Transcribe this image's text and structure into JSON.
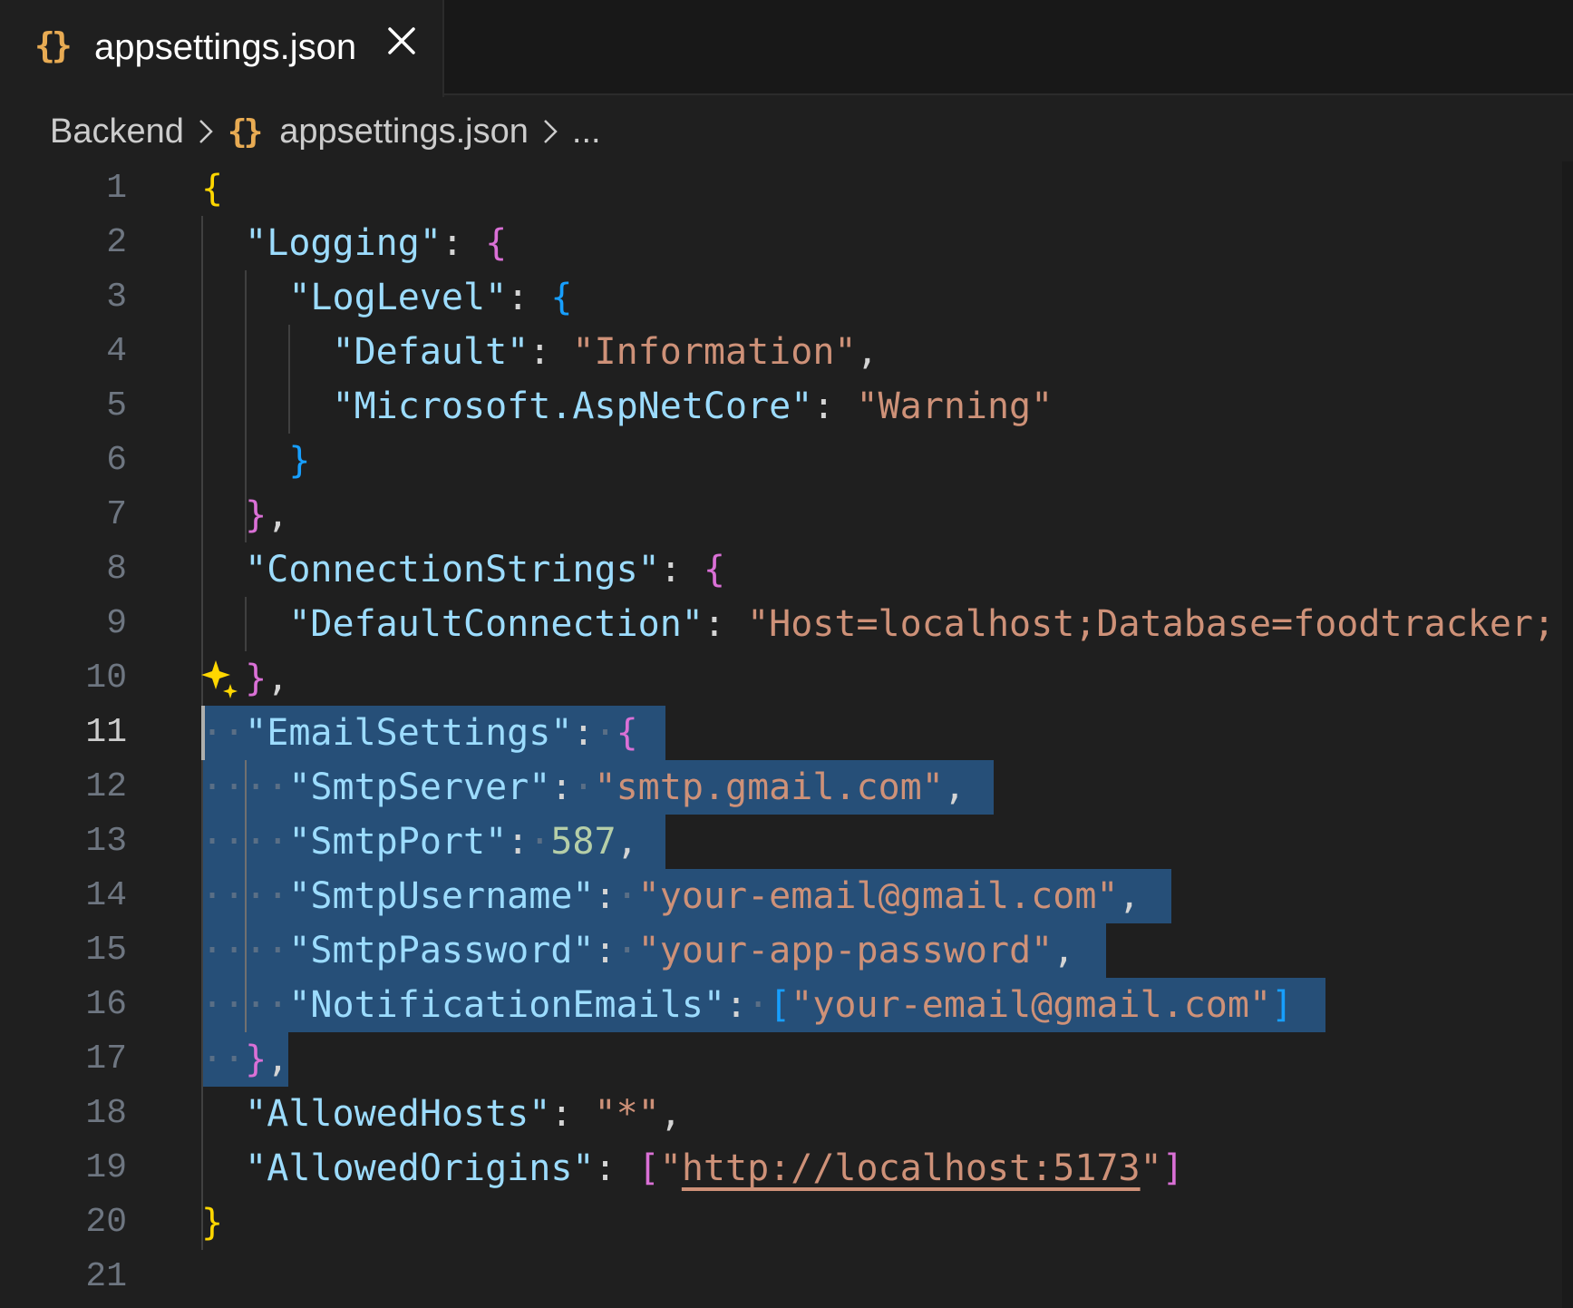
{
  "tab": {
    "icon": "{}",
    "filename": "appsettings.json",
    "close_icon": "close-icon"
  },
  "breadcrumb": {
    "folder": "Backend",
    "icon": "{}",
    "file": "appsettings.json",
    "more": "..."
  },
  "editor": {
    "active_line": 11,
    "line_numbers": [
      "1",
      "2",
      "3",
      "4",
      "5",
      "6",
      "7",
      "8",
      "9",
      "10",
      "11",
      "12",
      "13",
      "14",
      "15",
      "16",
      "17",
      "18",
      "19",
      "20",
      "21"
    ],
    "lines": [
      [
        {
          "t": "{",
          "c": "b1"
        }
      ],
      [
        {
          "t": "  "
        },
        {
          "t": "\"Logging\"",
          "c": "k"
        },
        {
          "t": ": ",
          "c": "p"
        },
        {
          "t": "{",
          "c": "b2"
        }
      ],
      [
        {
          "t": "    "
        },
        {
          "t": "\"LogLevel\"",
          "c": "k"
        },
        {
          "t": ": ",
          "c": "p"
        },
        {
          "t": "{",
          "c": "b3"
        }
      ],
      [
        {
          "t": "      "
        },
        {
          "t": "\"Default\"",
          "c": "k"
        },
        {
          "t": ": ",
          "c": "p"
        },
        {
          "t": "\"Information\"",
          "c": "s"
        },
        {
          "t": ",",
          "c": "p"
        }
      ],
      [
        {
          "t": "      "
        },
        {
          "t": "\"Microsoft.AspNetCore\"",
          "c": "k"
        },
        {
          "t": ": ",
          "c": "p"
        },
        {
          "t": "\"Warning\"",
          "c": "s"
        }
      ],
      [
        {
          "t": "    "
        },
        {
          "t": "}",
          "c": "b3"
        }
      ],
      [
        {
          "t": "  "
        },
        {
          "t": "}",
          "c": "b2"
        },
        {
          "t": ",",
          "c": "p"
        }
      ],
      [
        {
          "t": "  "
        },
        {
          "t": "\"ConnectionStrings\"",
          "c": "k"
        },
        {
          "t": ": ",
          "c": "p"
        },
        {
          "t": "{",
          "c": "b2"
        }
      ],
      [
        {
          "t": "    "
        },
        {
          "t": "\"DefaultConnection\"",
          "c": "k"
        },
        {
          "t": ": ",
          "c": "p"
        },
        {
          "t": "\"Host=localhost;Database=foodtracker;",
          "c": "s"
        }
      ],
      [
        {
          "t": "  "
        },
        {
          "t": "}",
          "c": "b2"
        },
        {
          "t": ",",
          "c": "p"
        }
      ],
      [
        {
          "t": "··",
          "c": "wsdot"
        },
        {
          "t": "\"EmailSettings\"",
          "c": "k"
        },
        {
          "t": ":",
          "c": "p"
        },
        {
          "t": "·",
          "c": "wsdot"
        },
        {
          "t": "{",
          "c": "b2"
        }
      ],
      [
        {
          "t": "····",
          "c": "wsdot"
        },
        {
          "t": "\"SmtpServer\"",
          "c": "k"
        },
        {
          "t": ":",
          "c": "p"
        },
        {
          "t": "·",
          "c": "wsdot"
        },
        {
          "t": "\"smtp.gmail.com\"",
          "c": "s"
        },
        {
          "t": ",",
          "c": "p"
        }
      ],
      [
        {
          "t": "····",
          "c": "wsdot"
        },
        {
          "t": "\"SmtpPort\"",
          "c": "k"
        },
        {
          "t": ":",
          "c": "p"
        },
        {
          "t": "·",
          "c": "wsdot"
        },
        {
          "t": "587",
          "c": "n"
        },
        {
          "t": ",",
          "c": "p"
        }
      ],
      [
        {
          "t": "····",
          "c": "wsdot"
        },
        {
          "t": "\"SmtpUsername\"",
          "c": "k"
        },
        {
          "t": ":",
          "c": "p"
        },
        {
          "t": "·",
          "c": "wsdot"
        },
        {
          "t": "\"your-email@gmail.com\"",
          "c": "s"
        },
        {
          "t": ",",
          "c": "p"
        }
      ],
      [
        {
          "t": "····",
          "c": "wsdot"
        },
        {
          "t": "\"SmtpPassword\"",
          "c": "k"
        },
        {
          "t": ":",
          "c": "p"
        },
        {
          "t": "·",
          "c": "wsdot"
        },
        {
          "t": "\"your-app-password\"",
          "c": "s"
        },
        {
          "t": ",",
          "c": "p"
        }
      ],
      [
        {
          "t": "····",
          "c": "wsdot"
        },
        {
          "t": "\"NotificationEmails\"",
          "c": "k"
        },
        {
          "t": ":",
          "c": "p"
        },
        {
          "t": "·",
          "c": "wsdot"
        },
        {
          "t": "[",
          "c": "b3"
        },
        {
          "t": "\"your-email@gmail.com\"",
          "c": "s"
        },
        {
          "t": "]",
          "c": "b3"
        }
      ],
      [
        {
          "t": "··",
          "c": "wsdot"
        },
        {
          "t": "}",
          "c": "b2"
        },
        {
          "t": ",",
          "c": "p"
        }
      ],
      [
        {
          "t": "  "
        },
        {
          "t": "\"AllowedHosts\"",
          "c": "k"
        },
        {
          "t": ": ",
          "c": "p"
        },
        {
          "t": "\"*\"",
          "c": "s"
        },
        {
          "t": ",",
          "c": "p"
        }
      ],
      [
        {
          "t": "  "
        },
        {
          "t": "\"AllowedOrigins\"",
          "c": "k"
        },
        {
          "t": ": ",
          "c": "p"
        },
        {
          "t": "[",
          "c": "b2"
        },
        {
          "t": "\"",
          "c": "s"
        },
        {
          "t": "http://localhost:5173",
          "c": "s link"
        },
        {
          "t": "\"",
          "c": "s"
        },
        {
          "t": "]",
          "c": "b2"
        }
      ],
      [
        {
          "t": "}",
          "c": "b1"
        }
      ],
      []
    ]
  },
  "colors": {
    "background": "#1f1f1f",
    "selection": "#264f78",
    "key": "#9cdcfe",
    "string": "#ce9178",
    "number": "#b5cea8",
    "bracket_gold": "#ffd700",
    "bracket_orchid": "#da70d6",
    "bracket_blue": "#179fff",
    "json_icon": "#e8ab53"
  },
  "sparkle_icon": "sparkle-icon"
}
